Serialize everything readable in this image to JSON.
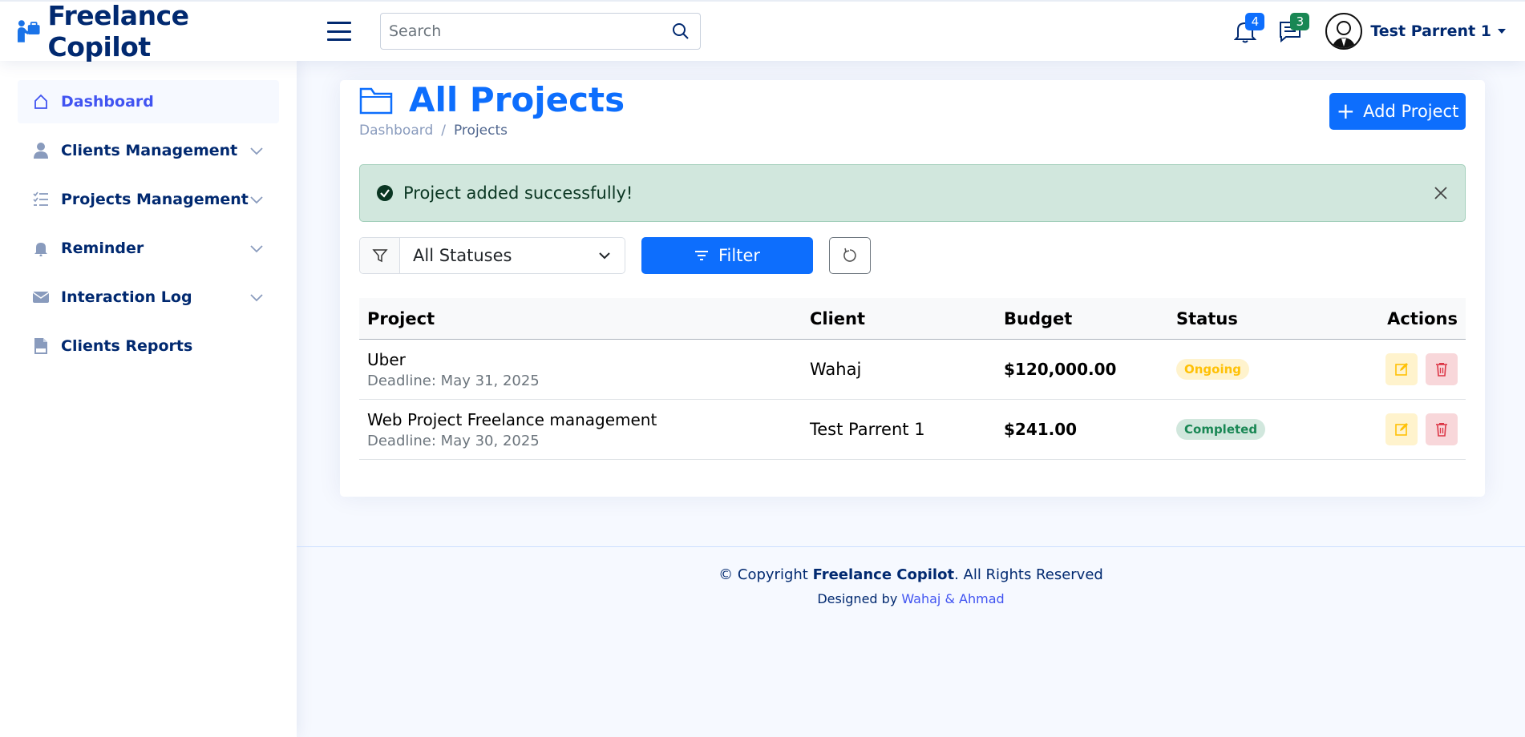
{
  "header": {
    "brand": "Freelance Copilot",
    "search_placeholder": "Search",
    "notifications_count": "4",
    "messages_count": "3",
    "user_name": "Test Parrent 1"
  },
  "sidebar": {
    "items": [
      {
        "label": "Dashboard",
        "icon": "home-icon",
        "active": true
      },
      {
        "label": "Clients Management",
        "icon": "person-icon"
      },
      {
        "label": "Projects Management",
        "icon": "list-icon"
      },
      {
        "label": "Reminder",
        "icon": "bell-icon"
      },
      {
        "label": "Interaction Log",
        "icon": "envelope-icon"
      },
      {
        "label": "Clients Reports",
        "icon": "pdf-icon"
      }
    ]
  },
  "page": {
    "title": "All Projects",
    "breadcrumb": [
      "Dashboard",
      "Projects"
    ],
    "add_button": "Add Project"
  },
  "alert": {
    "message": "Project added successfully!"
  },
  "filter": {
    "selected_status": "All Statuses",
    "button": "Filter"
  },
  "table": {
    "headers": [
      "Project",
      "Client",
      "Budget",
      "Status",
      "Actions"
    ],
    "rows": [
      {
        "project": "Uber",
        "deadline": "Deadline: May 31, 2025",
        "client": "Wahaj",
        "budget": "$120,000.00",
        "status": "Ongoing"
      },
      {
        "project": "Web Project Freelance management",
        "deadline": "Deadline: May 30, 2025",
        "client": "Test Parrent 1",
        "budget": "$241.00",
        "status": "Completed"
      }
    ]
  },
  "footer": {
    "copyright_prefix": "© Copyright",
    "brand": "Freelance Copilot",
    "copyright_suffix": ". All Rights Reserved",
    "designed_by": "Designed by",
    "authors": "Wahaj & Ahmad"
  },
  "colors": {
    "primary": "#0d6efd",
    "navy": "#012970",
    "ongoing_bg": "#fff3cd",
    "ongoing_fg": "#ffc107",
    "completed_bg": "#d1e7dd",
    "completed_fg": "#198754"
  }
}
